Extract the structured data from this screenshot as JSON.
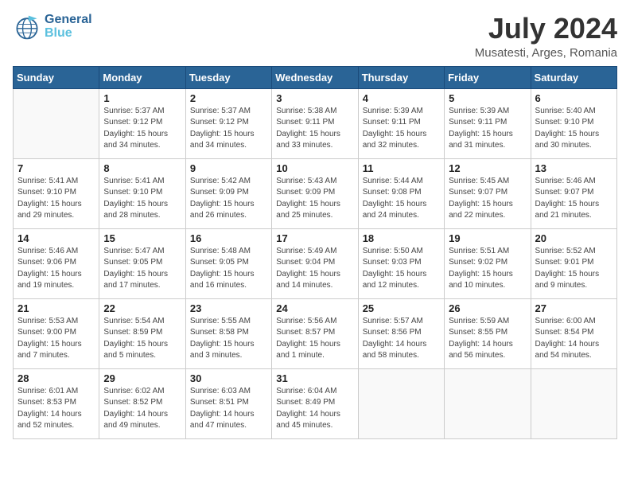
{
  "header": {
    "logo_general": "General",
    "logo_blue": "Blue",
    "month_title": "July 2024",
    "location": "Musatesti, Arges, Romania"
  },
  "days_of_week": [
    "Sunday",
    "Monday",
    "Tuesday",
    "Wednesday",
    "Thursday",
    "Friday",
    "Saturday"
  ],
  "weeks": [
    [
      {
        "day": "",
        "info": ""
      },
      {
        "day": "1",
        "info": "Sunrise: 5:37 AM\nSunset: 9:12 PM\nDaylight: 15 hours\nand 34 minutes."
      },
      {
        "day": "2",
        "info": "Sunrise: 5:37 AM\nSunset: 9:12 PM\nDaylight: 15 hours\nand 34 minutes."
      },
      {
        "day": "3",
        "info": "Sunrise: 5:38 AM\nSunset: 9:11 PM\nDaylight: 15 hours\nand 33 minutes."
      },
      {
        "day": "4",
        "info": "Sunrise: 5:39 AM\nSunset: 9:11 PM\nDaylight: 15 hours\nand 32 minutes."
      },
      {
        "day": "5",
        "info": "Sunrise: 5:39 AM\nSunset: 9:11 PM\nDaylight: 15 hours\nand 31 minutes."
      },
      {
        "day": "6",
        "info": "Sunrise: 5:40 AM\nSunset: 9:10 PM\nDaylight: 15 hours\nand 30 minutes."
      }
    ],
    [
      {
        "day": "7",
        "info": "Sunrise: 5:41 AM\nSunset: 9:10 PM\nDaylight: 15 hours\nand 29 minutes."
      },
      {
        "day": "8",
        "info": "Sunrise: 5:41 AM\nSunset: 9:10 PM\nDaylight: 15 hours\nand 28 minutes."
      },
      {
        "day": "9",
        "info": "Sunrise: 5:42 AM\nSunset: 9:09 PM\nDaylight: 15 hours\nand 26 minutes."
      },
      {
        "day": "10",
        "info": "Sunrise: 5:43 AM\nSunset: 9:09 PM\nDaylight: 15 hours\nand 25 minutes."
      },
      {
        "day": "11",
        "info": "Sunrise: 5:44 AM\nSunset: 9:08 PM\nDaylight: 15 hours\nand 24 minutes."
      },
      {
        "day": "12",
        "info": "Sunrise: 5:45 AM\nSunset: 9:07 PM\nDaylight: 15 hours\nand 22 minutes."
      },
      {
        "day": "13",
        "info": "Sunrise: 5:46 AM\nSunset: 9:07 PM\nDaylight: 15 hours\nand 21 minutes."
      }
    ],
    [
      {
        "day": "14",
        "info": "Sunrise: 5:46 AM\nSunset: 9:06 PM\nDaylight: 15 hours\nand 19 minutes."
      },
      {
        "day": "15",
        "info": "Sunrise: 5:47 AM\nSunset: 9:05 PM\nDaylight: 15 hours\nand 17 minutes."
      },
      {
        "day": "16",
        "info": "Sunrise: 5:48 AM\nSunset: 9:05 PM\nDaylight: 15 hours\nand 16 minutes."
      },
      {
        "day": "17",
        "info": "Sunrise: 5:49 AM\nSunset: 9:04 PM\nDaylight: 15 hours\nand 14 minutes."
      },
      {
        "day": "18",
        "info": "Sunrise: 5:50 AM\nSunset: 9:03 PM\nDaylight: 15 hours\nand 12 minutes."
      },
      {
        "day": "19",
        "info": "Sunrise: 5:51 AM\nSunset: 9:02 PM\nDaylight: 15 hours\nand 10 minutes."
      },
      {
        "day": "20",
        "info": "Sunrise: 5:52 AM\nSunset: 9:01 PM\nDaylight: 15 hours\nand 9 minutes."
      }
    ],
    [
      {
        "day": "21",
        "info": "Sunrise: 5:53 AM\nSunset: 9:00 PM\nDaylight: 15 hours\nand 7 minutes."
      },
      {
        "day": "22",
        "info": "Sunrise: 5:54 AM\nSunset: 8:59 PM\nDaylight: 15 hours\nand 5 minutes."
      },
      {
        "day": "23",
        "info": "Sunrise: 5:55 AM\nSunset: 8:58 PM\nDaylight: 15 hours\nand 3 minutes."
      },
      {
        "day": "24",
        "info": "Sunrise: 5:56 AM\nSunset: 8:57 PM\nDaylight: 15 hours\nand 1 minute."
      },
      {
        "day": "25",
        "info": "Sunrise: 5:57 AM\nSunset: 8:56 PM\nDaylight: 14 hours\nand 58 minutes."
      },
      {
        "day": "26",
        "info": "Sunrise: 5:59 AM\nSunset: 8:55 PM\nDaylight: 14 hours\nand 56 minutes."
      },
      {
        "day": "27",
        "info": "Sunrise: 6:00 AM\nSunset: 8:54 PM\nDaylight: 14 hours\nand 54 minutes."
      }
    ],
    [
      {
        "day": "28",
        "info": "Sunrise: 6:01 AM\nSunset: 8:53 PM\nDaylight: 14 hours\nand 52 minutes."
      },
      {
        "day": "29",
        "info": "Sunrise: 6:02 AM\nSunset: 8:52 PM\nDaylight: 14 hours\nand 49 minutes."
      },
      {
        "day": "30",
        "info": "Sunrise: 6:03 AM\nSunset: 8:51 PM\nDaylight: 14 hours\nand 47 minutes."
      },
      {
        "day": "31",
        "info": "Sunrise: 6:04 AM\nSunset: 8:49 PM\nDaylight: 14 hours\nand 45 minutes."
      },
      {
        "day": "",
        "info": ""
      },
      {
        "day": "",
        "info": ""
      },
      {
        "day": "",
        "info": ""
      }
    ]
  ]
}
